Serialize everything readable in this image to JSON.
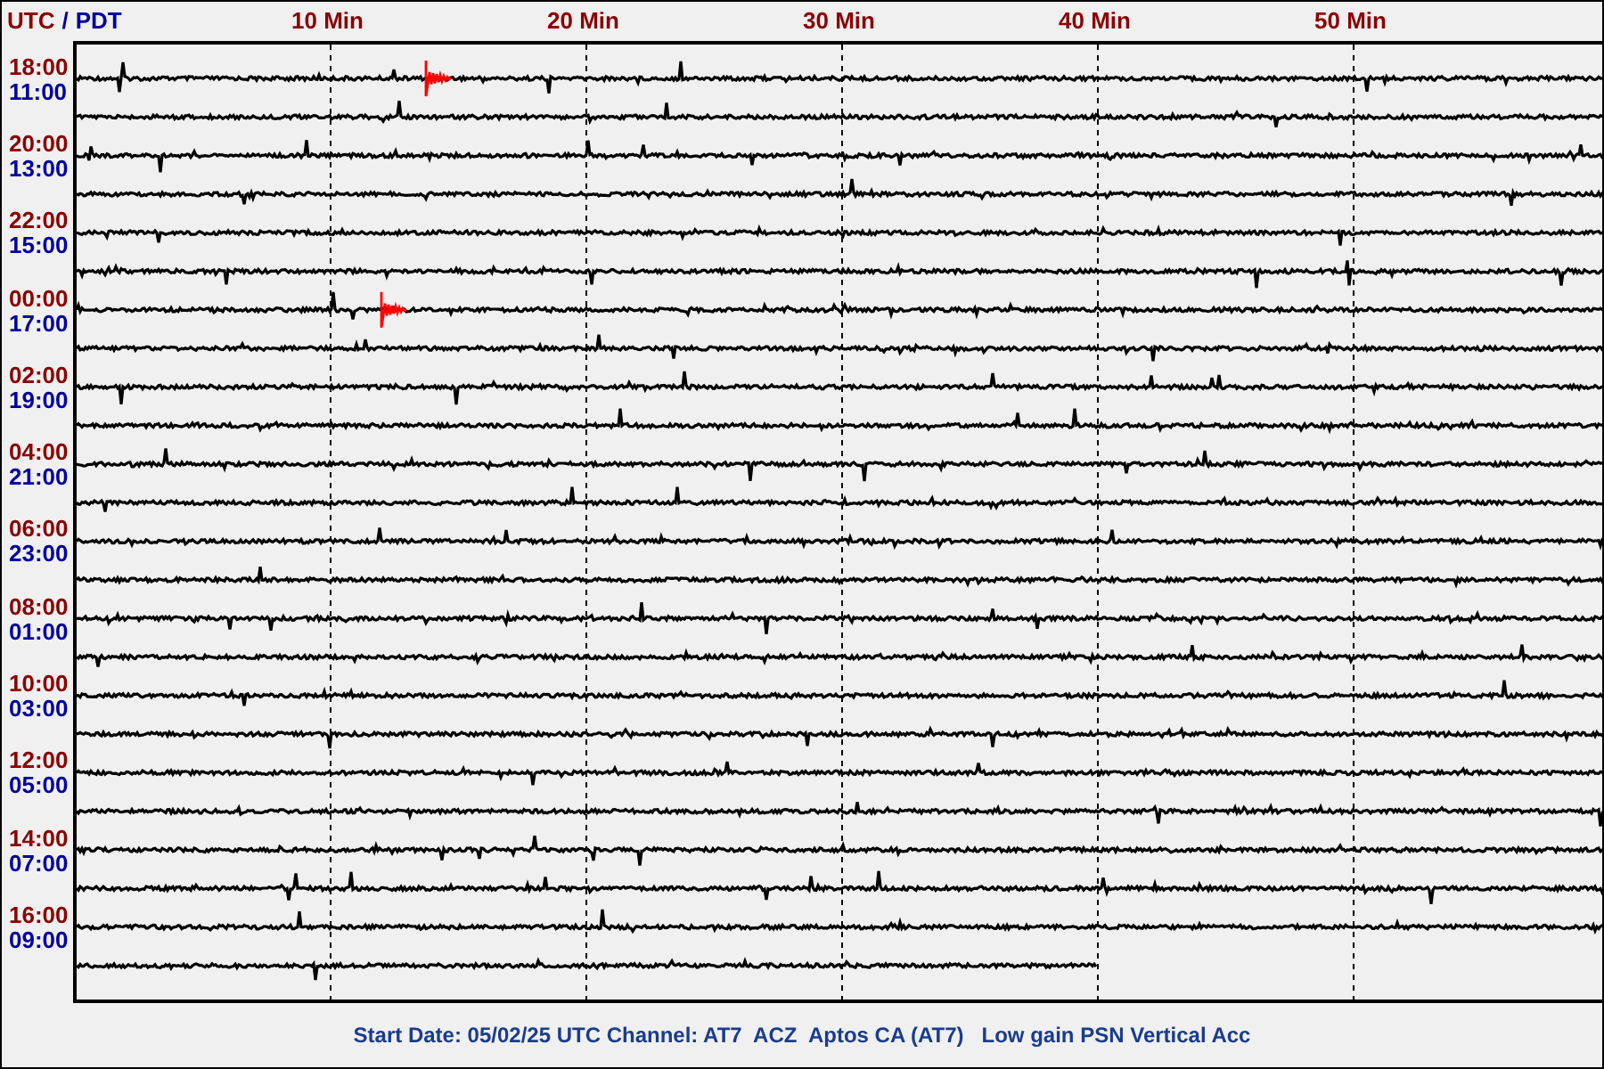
{
  "header": {
    "utc_label": "UTC",
    "separator": "/",
    "local_label": "PDT"
  },
  "x_ticks": [
    "10 Min",
    "20 Min",
    "30 Min",
    "40 Min",
    "50 Min"
  ],
  "time_labels": [
    {
      "utc": "18:00",
      "local": "11:00"
    },
    {
      "utc": "20:00",
      "local": "13:00"
    },
    {
      "utc": "22:00",
      "local": "15:00"
    },
    {
      "utc": "00:00",
      "local": "17:00"
    },
    {
      "utc": "02:00",
      "local": "19:00"
    },
    {
      "utc": "04:00",
      "local": "21:00"
    },
    {
      "utc": "06:00",
      "local": "23:00"
    },
    {
      "utc": "08:00",
      "local": "01:00"
    },
    {
      "utc": "10:00",
      "local": "03:00"
    },
    {
      "utc": "12:00",
      "local": "05:00"
    },
    {
      "utc": "14:00",
      "local": "07:00"
    },
    {
      "utc": "16:00",
      "local": "09:00"
    }
  ],
  "traces": [
    {
      "level": 1,
      "event": true
    },
    {
      "level": 1,
      "event": false
    },
    {
      "level": 1,
      "event": false
    },
    {
      "level": 1,
      "event": false
    },
    {
      "level": 1,
      "event": false
    },
    {
      "level": 1,
      "event": false
    },
    {
      "level": 1,
      "event": true
    },
    {
      "level": 1,
      "event": false
    },
    {
      "level": 1,
      "event": false
    },
    {
      "level": 1,
      "event": false
    },
    {
      "level": 1,
      "event": false
    },
    {
      "level": 1,
      "event": false
    },
    {
      "level": 1,
      "event": false
    },
    {
      "level": 1,
      "event": false
    },
    {
      "level": 1,
      "event": false
    },
    {
      "level": 1,
      "event": false
    },
    {
      "level": 1,
      "event": false
    },
    {
      "level": 1,
      "event": false
    },
    {
      "level": 1,
      "event": false
    },
    {
      "level": 1,
      "event": false
    },
    {
      "level": 1,
      "event": false
    },
    {
      "level": 1,
      "event": false
    },
    {
      "level": 1,
      "event": false
    },
    {
      "level": 0.667,
      "event": false
    }
  ],
  "footer": "Start Date: 05/02/25 UTC Channel: AT7  ACZ  Aptos CA (AT7)   Low gain PSN Vertical Acc"
}
